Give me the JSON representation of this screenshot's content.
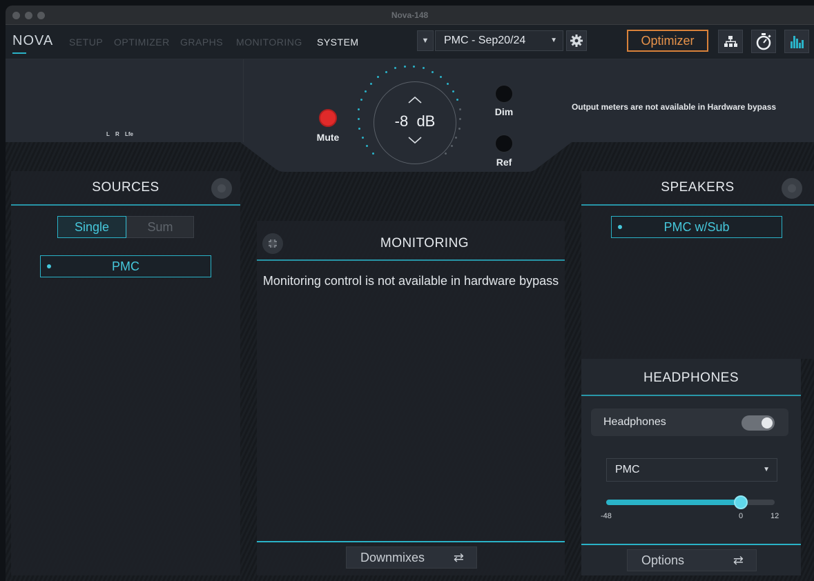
{
  "window": {
    "title": "Nova-148"
  },
  "nav": {
    "logo": "NOVA",
    "items": [
      "SETUP",
      "OPTIMIZER",
      "GRAPHS",
      "MONITORING",
      "SYSTEM"
    ],
    "active": "SYSTEM",
    "preset": "PMC - Sep20/24",
    "optimizer_button": "Optimizer",
    "icons": [
      "settings-gear-icon",
      "network-tree-icon",
      "stopwatch-icon",
      "bar-meter-icon"
    ]
  },
  "controls": {
    "meter_labels": "L R Lfe",
    "mute_label": "Mute",
    "volume_value": "-8",
    "volume_unit": "dB",
    "dim_label": "Dim",
    "ref_label": "Ref",
    "meters_notice": "Output meters are not available in Hardware bypass",
    "mute_color": "#e02a2a",
    "accent_color": "#2ab3c8"
  },
  "sources": {
    "title": "SOURCES",
    "mode_single": "Single",
    "mode_sum": "Sum",
    "selected_mode": "Single",
    "items": [
      "PMC"
    ]
  },
  "monitoring": {
    "title": "MONITORING",
    "message": "Monitoring control is not available in hardware bypass",
    "footer_button": "Downmixes"
  },
  "speakers": {
    "title": "SPEAKERS",
    "items": [
      "PMC w/Sub"
    ]
  },
  "headphones": {
    "title": "HEADPHONES",
    "toggle_label": "Headphones",
    "toggle_on": true,
    "output": "PMC",
    "level_fraction": 0.8,
    "tick_min": "-48",
    "tick_zero": "0",
    "tick_max": "12",
    "footer_button": "Options"
  }
}
